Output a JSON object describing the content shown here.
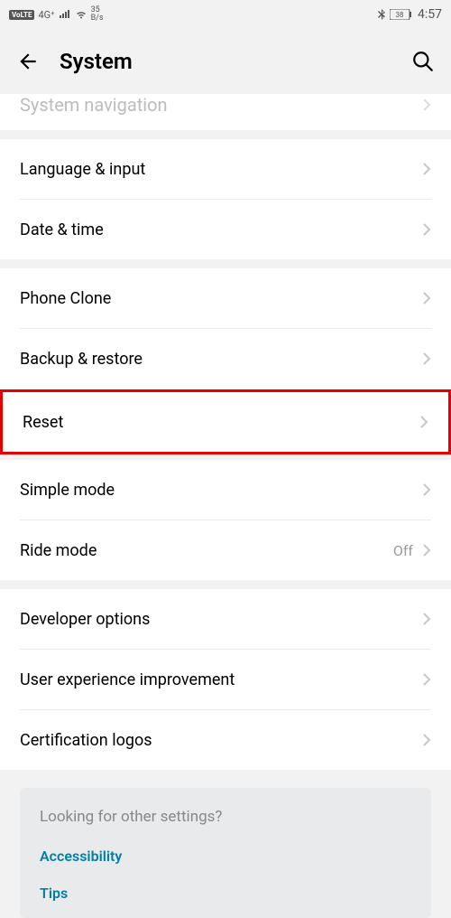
{
  "status": {
    "volte": "VoLTE",
    "network": "4G⁺",
    "data_rate_top": "35",
    "data_rate_bottom": "B/s",
    "battery": "38",
    "time": "4:57"
  },
  "header": {
    "title": "System"
  },
  "partial_row": {
    "label": "System navigation"
  },
  "groups": [
    {
      "rows": [
        {
          "label": "Language & input"
        },
        {
          "label": "Date & time"
        }
      ]
    },
    {
      "rows": [
        {
          "label": "Phone Clone"
        },
        {
          "label": "Backup & restore"
        }
      ]
    },
    {
      "reset_label": "Reset"
    },
    {
      "rows": [
        {
          "label": "Simple mode"
        },
        {
          "label": "Ride mode",
          "value": "Off"
        }
      ]
    },
    {
      "rows": [
        {
          "label": "Developer options"
        },
        {
          "label": "User experience improvement"
        },
        {
          "label": "Certification logos"
        }
      ]
    }
  ],
  "other": {
    "title": "Looking for other settings?",
    "links": [
      "Accessibility",
      "Tips"
    ]
  }
}
